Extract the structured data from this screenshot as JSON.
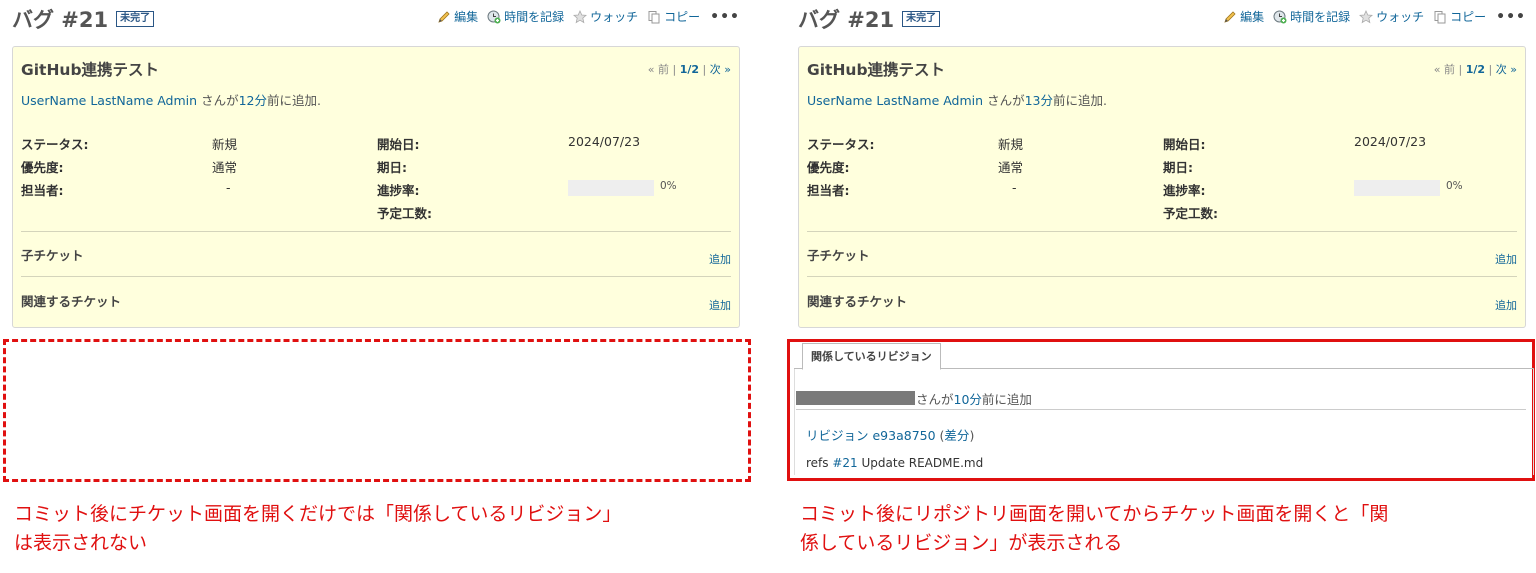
{
  "colors": {
    "accent": "#e01010",
    "link": "#116699",
    "issue_bg": "#ffffdd"
  },
  "toolbar": {
    "edit": "編集",
    "log_time": "時間を記録",
    "watch": "ウォッチ",
    "copy": "コピー",
    "more": "•••",
    "icons": {
      "edit": "pencil-icon",
      "log_time": "clock-add-icon",
      "watch": "star-icon",
      "copy": "copy-icon",
      "more": "more-icon"
    }
  },
  "issue": {
    "title": "バグ #21",
    "status_tag": "未完了",
    "subject": "GitHub連携テスト",
    "prev": "« 前",
    "sep1": "|",
    "page": "1/2",
    "sep2": "|",
    "next": "次 »",
    "author": "UserName LastName Admin",
    "added_suffix": "前に追加.",
    "labels": {
      "status": "ステータス:",
      "priority": "優先度:",
      "assignee": "担当者:",
      "start_date": "開始日:",
      "due_date": "期日:",
      "done_ratio": "進捗率:",
      "estimated": "予定工数:"
    },
    "values": {
      "status": "新規",
      "priority": "通常",
      "assignee": "-",
      "start_date": "2024/07/23",
      "done_ratio_text": "0%"
    },
    "progress": 0,
    "subtasks": "子チケット",
    "related": "関連するチケット",
    "add": "追加"
  },
  "left": {
    "san_ga": "さんが",
    "ago": "12分",
    "caption": "コミット後にチケット画面を開くだけでは「関係しているリビジョン」\nは表示されない"
  },
  "right": {
    "san_ga": "さんが",
    "ago": "13分",
    "revisions": {
      "tab": "関係しているリビジョン",
      "san_ga": "さんが",
      "ago": "10分",
      "added": "前に追加",
      "revision_prefix": "リビジョン ",
      "revision_id": "e93a8750",
      "diff_open": " (",
      "diff": "差分",
      "diff_close": ")",
      "msg_prefix": "refs ",
      "msg_ref": "#21",
      "msg_suffix": " Update README.md"
    },
    "caption": "コミット後にリポジトリ画面を開いてからチケット画面を開くと「関\n係しているリビジョン」が表示される"
  }
}
